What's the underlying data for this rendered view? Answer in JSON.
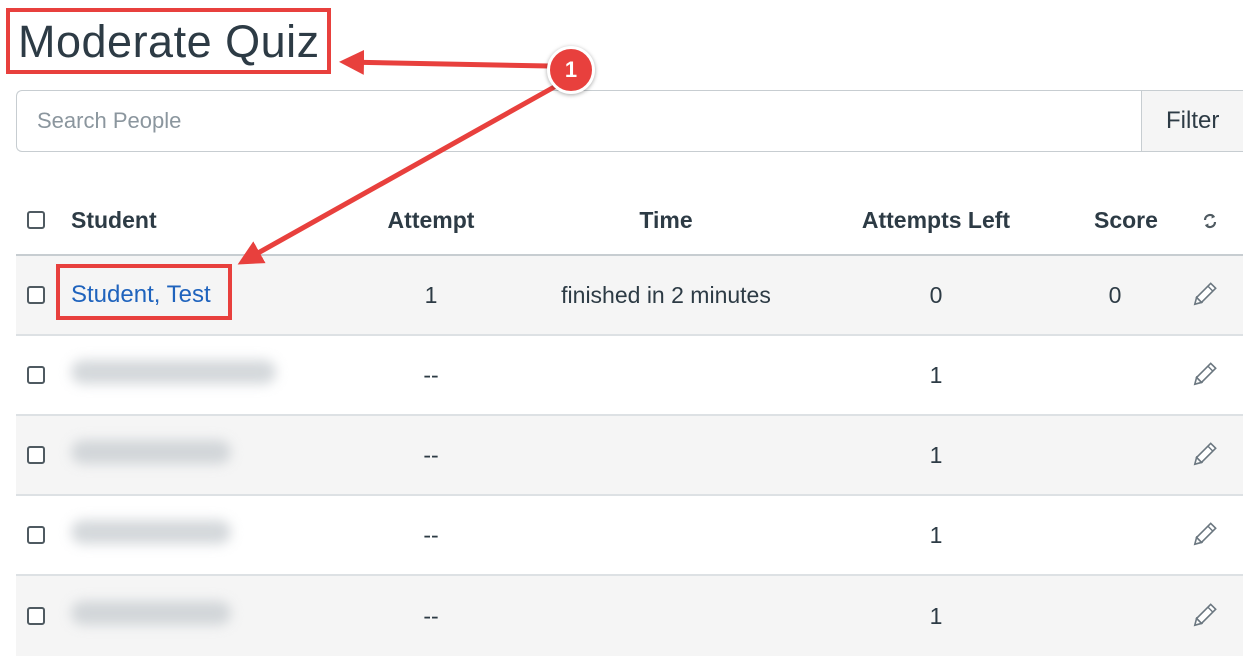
{
  "page": {
    "title": "Moderate Quiz"
  },
  "search": {
    "placeholder": "Search People",
    "filter_label": "Filter"
  },
  "table": {
    "columns": {
      "student": "Student",
      "attempt": "Attempt",
      "time": "Time",
      "attempts_left": "Attempts Left",
      "score": "Score"
    },
    "rows": [
      {
        "student": "Student, Test",
        "attempt": "1",
        "time": "finished in 2 minutes",
        "attempts_left": "0",
        "score": "0",
        "blurred": false
      },
      {
        "student": "",
        "attempt": "--",
        "time": "",
        "attempts_left": "1",
        "score": "",
        "blurred": true
      },
      {
        "student": "",
        "attempt": "--",
        "time": "",
        "attempts_left": "1",
        "score": "",
        "blurred": true
      },
      {
        "student": "",
        "attempt": "--",
        "time": "",
        "attempts_left": "1",
        "score": "",
        "blurred": true
      },
      {
        "student": "",
        "attempt": "--",
        "time": "",
        "attempts_left": "1",
        "score": "",
        "blurred": true
      }
    ]
  },
  "annotation": {
    "badge_number": "1",
    "color": "#e8403d"
  },
  "icons": {
    "refresh": "refresh-icon",
    "edit": "pencil-icon"
  },
  "colors": {
    "link": "#1f63bd",
    "text": "#2d3b45",
    "row_alt": "#f5f5f5"
  }
}
